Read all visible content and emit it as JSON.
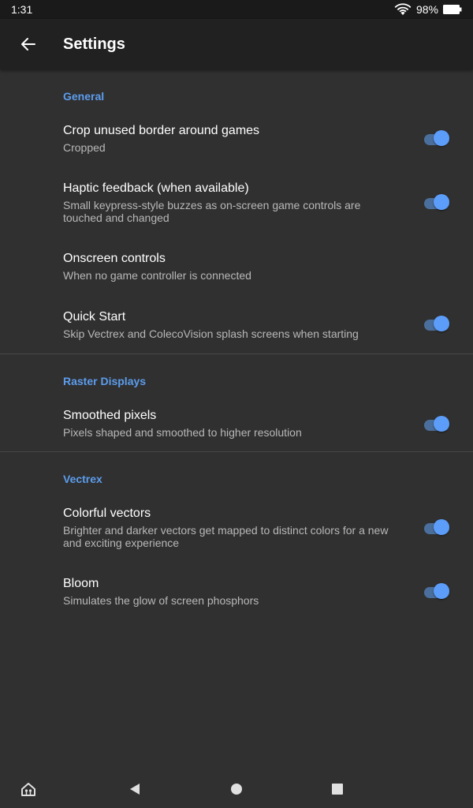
{
  "status_bar": {
    "time": "1:31",
    "battery": "98%",
    "icons": [
      "wifi-icon",
      "battery-icon"
    ]
  },
  "app_bar": {
    "title": "Settings",
    "back_icon": "arrow-left-icon"
  },
  "sections": [
    {
      "header": "General",
      "items": [
        {
          "title": "Crop unused border around games",
          "summary": "Cropped",
          "switch": true,
          "checked": true
        },
        {
          "title": "Haptic feedback (when available)",
          "summary": "Small keypress-style buzzes as on-screen game controls are touched and changed",
          "switch": true,
          "checked": true
        },
        {
          "title": "Onscreen controls",
          "summary": "When no game controller is connected",
          "switch": false
        },
        {
          "title": "Quick Start",
          "summary": "Skip Vectrex and ColecoVision splash screens when starting",
          "switch": true,
          "checked": true
        }
      ]
    },
    {
      "header": "Raster Displays",
      "items": [
        {
          "title": "Smoothed pixels",
          "summary": "Pixels shaped and smoothed to higher resolution",
          "switch": true,
          "checked": true
        }
      ]
    },
    {
      "header": "Vectrex",
      "items": [
        {
          "title": "Colorful vectors",
          "summary": "Brighter and darker vectors get mapped to distinct colors for a new and exciting experience",
          "switch": true,
          "checked": true
        },
        {
          "title": "Bloom",
          "summary": "Simulates the glow of screen phosphors",
          "switch": true,
          "checked": true
        }
      ]
    }
  ],
  "nav_bar": {
    "icons": [
      "home-icon",
      "back-triangle-icon",
      "home-circle-icon",
      "recents-square-icon"
    ]
  },
  "colors": {
    "accent": "#5c9ded",
    "background": "#303030",
    "app_bar": "#212121",
    "switch_thumb": "#5c9dfa",
    "switch_track": "#4b6f9c"
  }
}
